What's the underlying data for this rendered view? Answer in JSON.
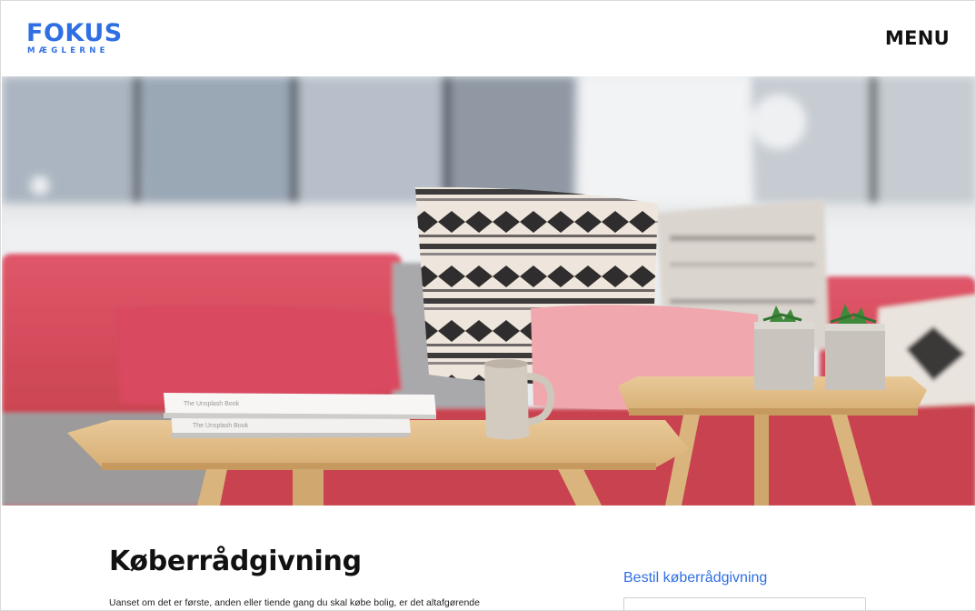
{
  "brand": {
    "name": "FOKUS",
    "tagline": "MÆGLERNE",
    "color": "#2f6fe4"
  },
  "header": {
    "menu_label": "MENU"
  },
  "hero": {
    "image": "living-room-sofa-photo",
    "book_title": "The Unsplash Book"
  },
  "main": {
    "title": "Køberrådgivning",
    "intro": "Uanset om det er første, anden eller tiende gang du skal købe bolig, er det altafgørende"
  },
  "sidebar": {
    "order_link": "Bestil køberrådgivning",
    "field_value": ""
  }
}
